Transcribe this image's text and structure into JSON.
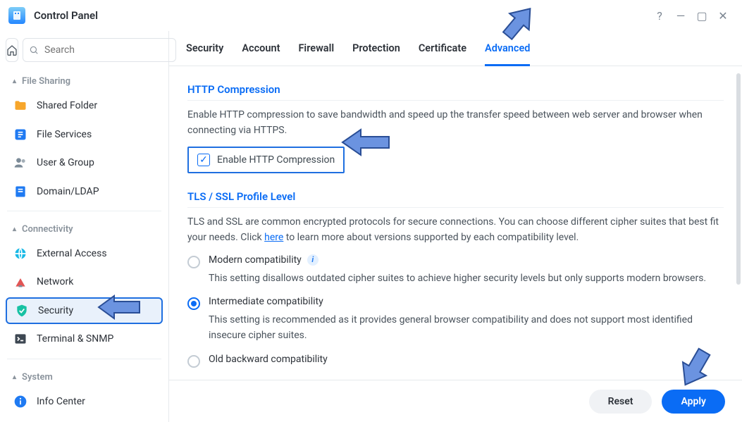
{
  "window": {
    "title": "Control Panel",
    "help": "?",
    "min": "—",
    "max": "▢",
    "close": "✕"
  },
  "search": {
    "placeholder": "Search"
  },
  "sidebar": {
    "sections": [
      {
        "label": "File Sharing",
        "items": [
          {
            "label": "Shared Folder"
          },
          {
            "label": "File Services"
          },
          {
            "label": "User & Group"
          },
          {
            "label": "Domain/LDAP"
          }
        ]
      },
      {
        "label": "Connectivity",
        "items": [
          {
            "label": "External Access"
          },
          {
            "label": "Network"
          },
          {
            "label": "Security"
          },
          {
            "label": "Terminal & SNMP"
          }
        ]
      },
      {
        "label": "System",
        "items": [
          {
            "label": "Info Center"
          }
        ]
      }
    ]
  },
  "tabs": [
    {
      "label": "Security"
    },
    {
      "label": "Account"
    },
    {
      "label": "Firewall"
    },
    {
      "label": "Protection"
    },
    {
      "label": "Certificate"
    },
    {
      "label": "Advanced"
    }
  ],
  "http": {
    "title": "HTTP Compression",
    "desc": "Enable HTTP compression to save bandwidth and speed up the transfer speed between web server and browser when connecting via HTTPS.",
    "checkbox_label": "Enable HTTP Compression"
  },
  "tls": {
    "title": "TLS / SSL Profile Level",
    "desc_pre": "TLS and SSL are common encrypted protocols for secure connections. You can choose different cipher suites that best fit your needs. Click ",
    "desc_link": "here",
    "desc_post": " to learn more about versions supported by each compatibility level.",
    "options": [
      {
        "label": "Modern compatibility",
        "desc": "This setting disallows outdated cipher suites to achieve higher security levels but only supports modern browsers.",
        "checked": false,
        "info": true
      },
      {
        "label": "Intermediate compatibility",
        "desc": "This setting is recommended as it provides general browser compatibility and does not support most identified insecure cipher suites.",
        "checked": true,
        "info": false
      },
      {
        "label": "Old backward compatibility",
        "desc": "",
        "checked": false,
        "info": false
      }
    ]
  },
  "footer": {
    "reset": "Reset",
    "apply": "Apply"
  }
}
